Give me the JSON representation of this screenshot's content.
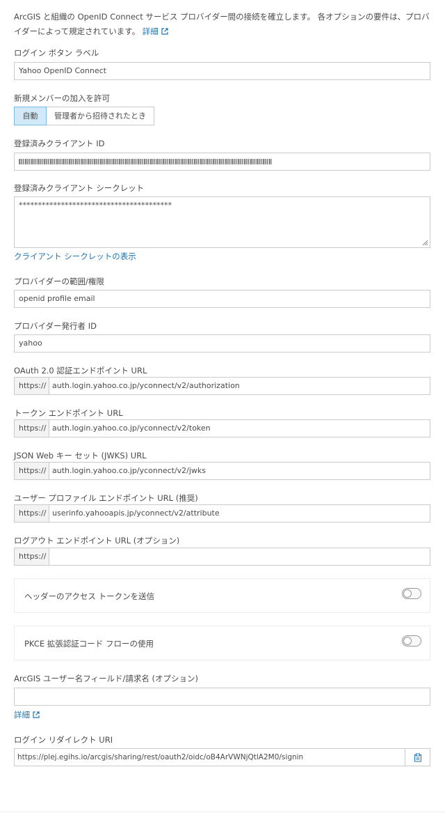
{
  "intro": {
    "text": "ArcGIS と組織の OpenID Connect サービス プロバイダー間の接続を確立します。 各オプションの要件は、プロバイダーによって規定されています。",
    "link_label": "詳細"
  },
  "login_button": {
    "label": "ログイン ボタン ラベル",
    "value": "Yahoo OpenID Connect"
  },
  "new_members": {
    "label": "新規メンバーの加入を許可",
    "options": [
      "自動",
      "管理者から招待されたとき"
    ],
    "selected": "自動"
  },
  "client_id": {
    "label": "登録済みクライアント ID"
  },
  "client_secret": {
    "label": "登録済みクライアント シークレット",
    "value": "****************************************",
    "show_link": "クライアント シークレットの表示"
  },
  "scope": {
    "label": "プロバイダーの範囲/権限",
    "value": "openid profile email"
  },
  "issuer": {
    "label": "プロバイダー発行者 ID",
    "value": "yahoo"
  },
  "oauth_url": {
    "label": "OAuth 2.0 認証エンドポイント URL",
    "prefix": "https://",
    "value": "auth.login.yahoo.co.jp/yconnect/v2/authorization"
  },
  "token_url": {
    "label": "トークン エンドポイント URL",
    "prefix": "https://",
    "value": "auth.login.yahoo.co.jp/yconnect/v2/token"
  },
  "jwks_url": {
    "label": "JSON Web キー セット (JWKS) URL",
    "prefix": "https://",
    "value": "auth.login.yahoo.co.jp/yconnect/v2/jwks"
  },
  "userinfo_url": {
    "label": "ユーザー プロファイル エンドポイント URL (推奨)",
    "prefix": "https://",
    "value": "userinfo.yahooapis.jp/yconnect/v2/attribute"
  },
  "logout_url": {
    "label": "ログアウト エンドポイント URL (オプション)",
    "prefix": "https://",
    "value": ""
  },
  "toggles": [
    {
      "label": "ヘッダーのアクセス トークンを送信",
      "on": false
    },
    {
      "label": "PKCE 拡張認証コード フローの使用",
      "on": false
    }
  ],
  "username_claim": {
    "label": "ArcGIS ユーザー名フィールド/請求名 (オプション)",
    "value": "",
    "link_label": "詳細"
  },
  "redirect_uri": {
    "label": "ログイン リダイレクト URI",
    "value": "https://plej.egihs.io/arcgis/sharing/rest/oauth2/oidc/oB4ArVWNjQtlA2M0/signin"
  },
  "colors": {
    "link": "#1e74b0",
    "active_segment": "#d2e9f9",
    "border": "#cacaca",
    "prefix_bg": "#f3f3f3"
  },
  "icons": {
    "external": "external-link-icon",
    "copy": "copy-icon",
    "resize": "resize-handle-icon"
  }
}
